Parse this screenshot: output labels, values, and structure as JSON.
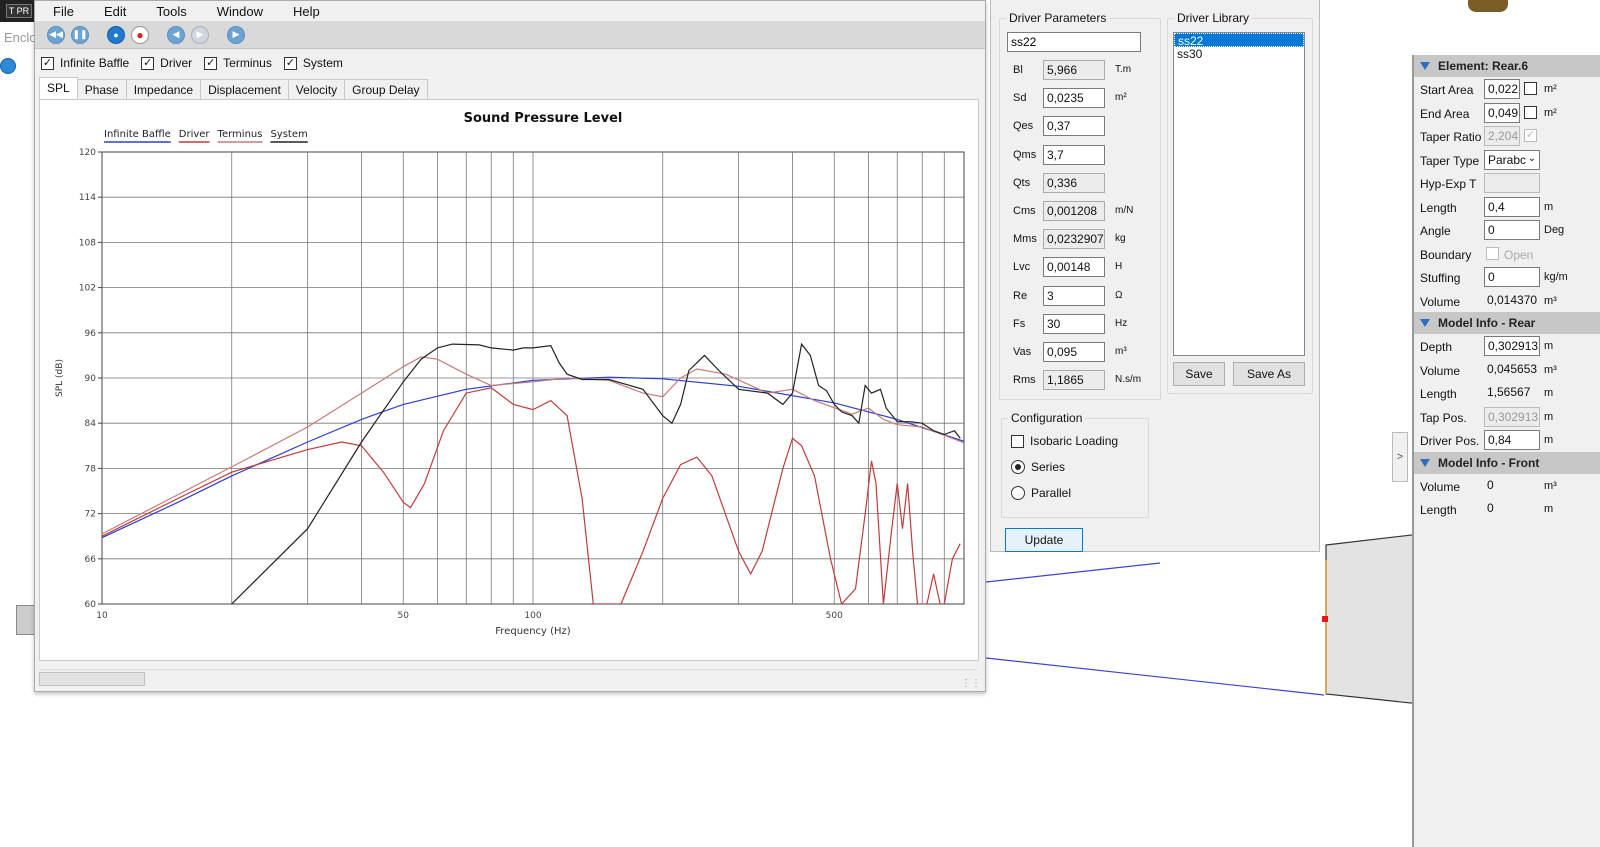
{
  "background": {
    "badge_text": "T PR",
    "enclosure_label": "Enclo"
  },
  "menu": [
    "File",
    "Edit",
    "Tools",
    "Window",
    "Help"
  ],
  "toolbar_icons": [
    "rewind-icon",
    "pause-icon",
    "record-blue-icon",
    "record-red-icon",
    "prev-icon",
    "next-disabled-icon",
    "play-icon"
  ],
  "checkboxes": [
    {
      "label": "Infinite Baffle",
      "checked": true
    },
    {
      "label": "Driver",
      "checked": true
    },
    {
      "label": "Terminus",
      "checked": true
    },
    {
      "label": "System",
      "checked": true
    }
  ],
  "tabs": [
    "SPL",
    "Phase",
    "Impedance",
    "Displacement",
    "Velocity",
    "Group Delay"
  ],
  "active_tab": "SPL",
  "chart_data": {
    "type": "line",
    "title": "Sound Pressure Level",
    "xlabel": "Frequency (Hz)",
    "ylabel": "SPL (dB)",
    "x_scale": "log",
    "xlim": [
      10,
      1000
    ],
    "ylim": [
      60,
      120
    ],
    "y_ticks": [
      60,
      66,
      72,
      78,
      84,
      90,
      96,
      102,
      108,
      114,
      120
    ],
    "x_tick_labels": [
      {
        "value": 10,
        "label": "10"
      },
      {
        "value": 50,
        "label": "50"
      },
      {
        "value": 100,
        "label": "100"
      },
      {
        "value": 500,
        "label": "500"
      }
    ],
    "grid": true,
    "legend": "top-left",
    "series": [
      {
        "name": "Infinite Baffle",
        "color": "#2b3fd4",
        "points": [
          [
            10,
            68.8
          ],
          [
            15,
            73.5
          ],
          [
            20,
            77
          ],
          [
            30,
            81.5
          ],
          [
            40,
            84.5
          ],
          [
            50,
            86.5
          ],
          [
            70,
            88.5
          ],
          [
            100,
            89.7
          ],
          [
            150,
            90.1
          ],
          [
            200,
            89.9
          ],
          [
            300,
            88.9
          ],
          [
            500,
            86.7
          ],
          [
            700,
            84.5
          ],
          [
            1000,
            81.6
          ]
        ]
      },
      {
        "name": "Driver",
        "color": "#c23b3b",
        "points": [
          [
            10,
            69
          ],
          [
            15,
            74
          ],
          [
            20,
            77.5
          ],
          [
            30,
            80.5
          ],
          [
            36,
            81.5
          ],
          [
            40,
            81
          ],
          [
            45,
            77.5
          ],
          [
            50,
            73.5
          ],
          [
            52,
            72.8
          ],
          [
            56,
            76
          ],
          [
            62,
            83
          ],
          [
            70,
            88
          ],
          [
            80,
            88.7
          ],
          [
            90,
            86.5
          ],
          [
            100,
            85.8
          ],
          [
            110,
            87
          ],
          [
            120,
            85
          ],
          [
            130,
            74
          ],
          [
            138,
            60
          ],
          [
            160,
            60
          ],
          [
            180,
            67
          ],
          [
            200,
            74
          ],
          [
            220,
            78.5
          ],
          [
            240,
            79.5
          ],
          [
            260,
            77
          ],
          [
            300,
            67
          ],
          [
            320,
            64
          ],
          [
            340,
            67
          ],
          [
            380,
            78
          ],
          [
            400,
            82
          ],
          [
            420,
            81
          ],
          [
            450,
            77
          ],
          [
            490,
            66
          ],
          [
            520,
            60
          ],
          [
            560,
            62
          ],
          [
            590,
            72
          ],
          [
            610,
            79
          ],
          [
            625,
            76
          ],
          [
            650,
            60
          ],
          [
            680,
            70
          ],
          [
            700,
            76
          ],
          [
            720,
            70
          ],
          [
            740,
            76
          ],
          [
            760,
            67
          ],
          [
            780,
            60
          ],
          [
            820,
            60
          ],
          [
            850,
            64
          ],
          [
            880,
            60
          ],
          [
            900,
            60
          ],
          [
            940,
            66
          ],
          [
            980,
            68
          ]
        ]
      },
      {
        "name": "Terminus",
        "color": "#c97a7a",
        "points": [
          [
            10,
            69.3
          ],
          [
            20,
            78.2
          ],
          [
            30,
            83.5
          ],
          [
            40,
            88
          ],
          [
            50,
            91.5
          ],
          [
            55,
            92.8
          ],
          [
            60,
            92.5
          ],
          [
            70,
            90.5
          ],
          [
            80,
            89
          ],
          [
            100,
            89.5
          ],
          [
            120,
            90
          ],
          [
            150,
            89.7
          ],
          [
            180,
            88
          ],
          [
            200,
            87.5
          ],
          [
            220,
            90
          ],
          [
            240,
            91.2
          ],
          [
            280,
            90.5
          ],
          [
            350,
            88
          ],
          [
            400,
            88.5
          ],
          [
            450,
            87
          ],
          [
            550,
            85.2
          ],
          [
            600,
            86
          ],
          [
            650,
            84.5
          ],
          [
            700,
            83.8
          ],
          [
            800,
            83.5
          ],
          [
            1000,
            81.4
          ]
        ]
      },
      {
        "name": "System",
        "color": "#222222",
        "points": [
          [
            20,
            60
          ],
          [
            30,
            70
          ],
          [
            40,
            81.5
          ],
          [
            50,
            89.5
          ],
          [
            55,
            92.5
          ],
          [
            60,
            94
          ],
          [
            65,
            94.5
          ],
          [
            75,
            94.4
          ],
          [
            80,
            94
          ],
          [
            90,
            93.7
          ],
          [
            95,
            94
          ],
          [
            100,
            94
          ],
          [
            110,
            94.3
          ],
          [
            115,
            92
          ],
          [
            120,
            90.5
          ],
          [
            130,
            89.8
          ],
          [
            150,
            89.8
          ],
          [
            180,
            88.5
          ],
          [
            200,
            85
          ],
          [
            210,
            84
          ],
          [
            220,
            86.5
          ],
          [
            230,
            91
          ],
          [
            250,
            93
          ],
          [
            270,
            91
          ],
          [
            300,
            88.5
          ],
          [
            350,
            88
          ],
          [
            380,
            86.5
          ],
          [
            400,
            88
          ],
          [
            420,
            94.5
          ],
          [
            440,
            93
          ],
          [
            460,
            89
          ],
          [
            480,
            88.3
          ],
          [
            500,
            86.5
          ],
          [
            520,
            85.5
          ],
          [
            550,
            85
          ],
          [
            570,
            84
          ],
          [
            590,
            89
          ],
          [
            610,
            88
          ],
          [
            640,
            88.5
          ],
          [
            660,
            86
          ],
          [
            700,
            84.2
          ],
          [
            750,
            84.2
          ],
          [
            800,
            84
          ],
          [
            850,
            83
          ],
          [
            900,
            82.5
          ],
          [
            950,
            83
          ],
          [
            980,
            82
          ]
        ]
      }
    ]
  },
  "driver_parameters": {
    "title": "Driver Parameters",
    "name": "ss22",
    "params": [
      {
        "label": "Bl",
        "value": "5,966",
        "unit": "T.m",
        "readonly": true
      },
      {
        "label": "Sd",
        "value": "0,0235",
        "unit": "m²",
        "readonly": false
      },
      {
        "label": "Qes",
        "value": "0,37",
        "unit": "",
        "readonly": false
      },
      {
        "label": "Qms",
        "value": "3,7",
        "unit": "",
        "readonly": false
      },
      {
        "label": "Qts",
        "value": "0,336",
        "unit": "",
        "readonly": true
      },
      {
        "label": "Cms",
        "value": "0,001208",
        "unit": "m/N",
        "readonly": true
      },
      {
        "label": "Mms",
        "value": "0,0232907",
        "unit": "kg",
        "readonly": true
      },
      {
        "label": "Lvc",
        "value": "0,00148",
        "unit": "H",
        "readonly": false
      },
      {
        "label": "Re",
        "value": "3",
        "unit": "Ω",
        "readonly": false
      },
      {
        "label": "Fs",
        "value": "30",
        "unit": "Hz",
        "readonly": false
      },
      {
        "label": "Vas",
        "value": "0,095",
        "unit": "m³",
        "readonly": false
      },
      {
        "label": "Rms",
        "value": "1,1865",
        "unit": "N.s/m",
        "readonly": true
      }
    ]
  },
  "driver_library": {
    "title": "Driver Library",
    "items": [
      "ss22",
      "ss30"
    ],
    "selected": "ss22",
    "save": "Save",
    "save_as": "Save As"
  },
  "configuration": {
    "title": "Configuration",
    "isobaric": "Isobaric Loading",
    "series": "Series",
    "parallel": "Parallel",
    "selected": "Series"
  },
  "update_button": "Update",
  "element_panel": {
    "title": "Element: Rear.6",
    "start_area": {
      "label": "Start Area",
      "value": "0,022",
      "unit": "m²"
    },
    "end_area": {
      "label": "End Area",
      "value": "0,049",
      "unit": "m²"
    },
    "taper_ratio": {
      "label": "Taper Ratio",
      "value": "2,204"
    },
    "taper_type": {
      "label": "Taper Type",
      "value": "Parabc"
    },
    "hyp_exp": {
      "label": "Hyp-Exp T"
    },
    "length": {
      "label": "Length",
      "value": "0,4",
      "unit": "m"
    },
    "angle": {
      "label": "Angle",
      "value": "0",
      "unit": "Deg"
    },
    "boundary": {
      "label": "Boundary",
      "option": "Open"
    },
    "stuffing": {
      "label": "Stuffing",
      "value": "0",
      "unit": "kg/m"
    },
    "volume": {
      "label": "Volume",
      "value": "0,014370",
      "unit": "m³"
    }
  },
  "model_rear": {
    "title": "Model Info - Rear",
    "depth": {
      "label": "Depth",
      "value": "0,302913",
      "unit": "m"
    },
    "volume": {
      "label": "Volume",
      "value": "0,045653",
      "unit": "m³"
    },
    "length": {
      "label": "Length",
      "value": "1,56567",
      "unit": "m"
    },
    "tap_pos": {
      "label": "Tap Pos.",
      "value": "0,302913",
      "unit": "m"
    },
    "driver_pos": {
      "label": "Driver Pos.",
      "value": "0,84",
      "unit": "m"
    }
  },
  "model_front": {
    "title": "Model Info - Front",
    "volume": {
      "label": "Volume",
      "value": "0",
      "unit": "m³"
    },
    "length": {
      "label": "Length",
      "value": "0",
      "unit": "m"
    }
  }
}
